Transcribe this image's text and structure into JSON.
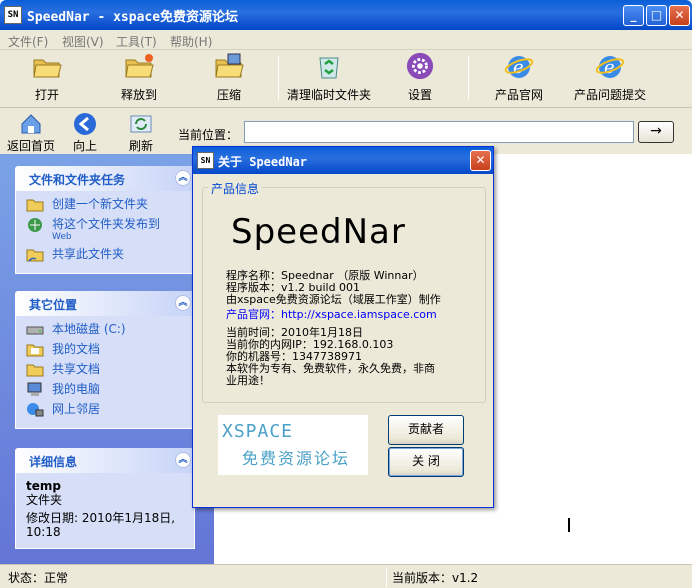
{
  "window": {
    "icon_text": "SN",
    "title": "SpeedNar - xspace免费资源论坛",
    "min": "_",
    "max": "□",
    "close": "✕"
  },
  "menu": [
    "文件(F)",
    "视图(V)",
    "工具(T)",
    "帮助(H)"
  ],
  "toolbar": [
    {
      "label": "打开",
      "icon": "open-folder-icon"
    },
    {
      "label": "释放到",
      "icon": "extract-folder-icon"
    },
    {
      "label": "压缩",
      "icon": "compress-icon"
    },
    {
      "label": "清理临时文件夹",
      "icon": "recycle-bin-icon"
    },
    {
      "label": "设置",
      "icon": "gear-icon"
    },
    {
      "label": "产品官网",
      "icon": "ie-browser-icon"
    },
    {
      "label": "产品问题提交",
      "icon": "ie-browser-icon"
    }
  ],
  "nav": {
    "home": "返回首页",
    "up": "向上",
    "refresh": "刷新",
    "address_label": "当前位置：",
    "address_value": "",
    "go": "→"
  },
  "left_panel": {
    "tasks": {
      "title": "文件和文件夹任务",
      "items": [
        {
          "label": "创建一个新文件夹",
          "sub": ""
        },
        {
          "label": "将这个文件夹发布到",
          "sub": "Web"
        },
        {
          "label": "共享此文件夹",
          "sub": ""
        }
      ]
    },
    "places": {
      "title": "其它位置",
      "items": [
        "本地磁盘 (C:)",
        "我的文档",
        "共享文档",
        "我的电脑",
        "网上邻居"
      ]
    },
    "details": {
      "title": "详细信息",
      "name": "temp",
      "type": "文件夹",
      "modified": "修改日期: 2010年1月18日, 10:18"
    }
  },
  "statusbar": {
    "status": "状态：正常",
    "version": "当前版本：v1.2"
  },
  "about": {
    "title": "关于 SpeedNar",
    "group_label": "产品信息",
    "logo": "SpeedNar",
    "lines": [
      "程序名称：Speednar （原版 Winnar）",
      "程序版本：v1.2 build 001",
      "由xspace免费资源论坛（域展工作室）制作",
      "产品官网：http://xspace.iamspace.com",
      "当前时间：2010年1月18日",
      "当前你的内网IP：192.168.0.103",
      "你的机器号：1347738971",
      "本软件为专有、免费软件，永久免费，非商",
      "业用途！"
    ],
    "banner_line1": "XSPACE",
    "banner_line2": "免费资源论坛",
    "donate": "贡献者",
    "close": "关  闭"
  }
}
